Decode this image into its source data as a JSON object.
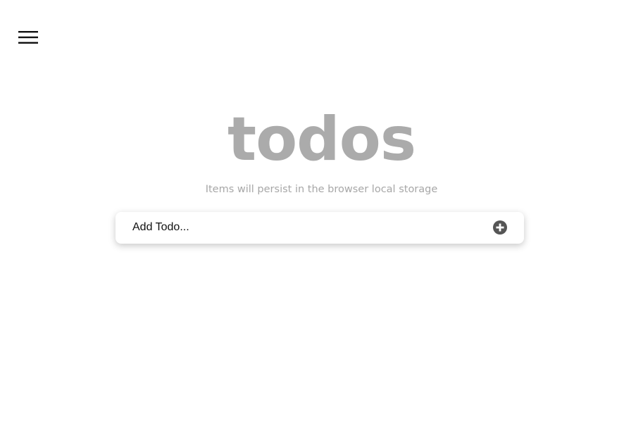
{
  "header": {
    "menu_icon": "hamburger-menu-icon"
  },
  "main": {
    "title": "todos",
    "subtitle": "Items will persist in the browser local storage"
  },
  "add_todo": {
    "placeholder": "Add Todo...",
    "value": "",
    "add_icon": "plus-circle-icon"
  },
  "colors": {
    "title": "#ababab",
    "subtitle": "#a7a7a7",
    "icon": "#555555",
    "background": "#ffffff"
  }
}
